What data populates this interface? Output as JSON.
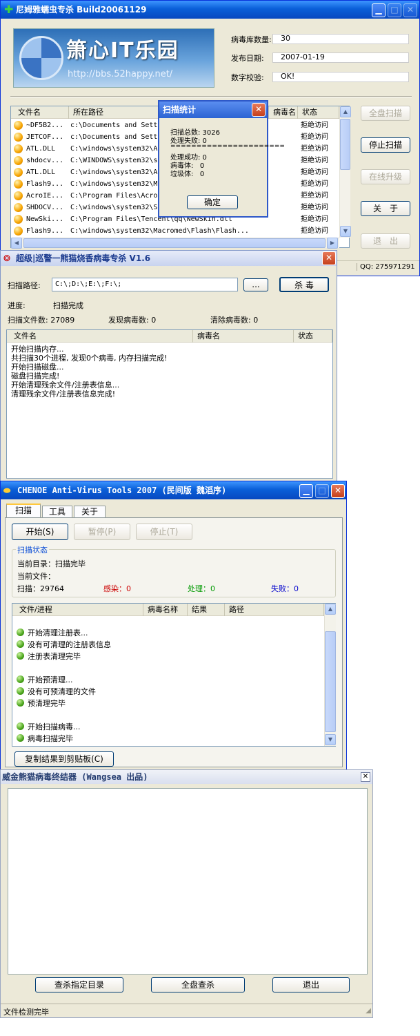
{
  "win1": {
    "title": "尼姆雅蠕虫专杀  Build20061129",
    "logo_text": "箫心IT乐园",
    "logo_url": "http://bbs.52happy.net/",
    "info": [
      {
        "label": "病毒库数量:",
        "value": "30"
      },
      {
        "label": "发布日期:",
        "value": "2007-01-19"
      },
      {
        "label": "数字校验:",
        "value": "OK!"
      }
    ],
    "columns": [
      "文件名",
      "所在路径",
      "病毒名",
      "状态"
    ],
    "rows": [
      {
        "name": "~DF5B2...",
        "path": "c:\\Documents and Sett",
        "status": "拒绝访问"
      },
      {
        "name": "JETCOF...",
        "path": "c:\\Documents and Sett",
        "status": "拒绝访问"
      },
      {
        "name": "ATL.DLL",
        "path": "C:\\windows\\system32\\A",
        "status": "拒绝访问"
      },
      {
        "name": "shdocv...",
        "path": "C:\\WINDOWS\\system32\\s",
        "status": "拒绝访问"
      },
      {
        "name": "ATL.DLL",
        "path": "C:\\windows\\system32\\A",
        "status": "拒绝访问"
      },
      {
        "name": "Flash9...",
        "path": "C:\\windows\\system32\\M",
        "status": "拒绝访问"
      },
      {
        "name": "AcroIE...",
        "path": "C:\\Program Files\\Acro",
        "status": "拒绝访问"
      },
      {
        "name": "SHDOCV...",
        "path": "C:\\windows\\system32\\S",
        "status": "拒绝访问"
      },
      {
        "name": "NewSki...",
        "path": "C:\\Program Files\\Tencent\\qq\\NewSkin.dll",
        "status": "拒绝访问"
      },
      {
        "name": "Flash9...",
        "path": "C:\\windows\\system32\\Macromed\\Flash\\Flash...",
        "status": "拒绝访问"
      }
    ],
    "buttons": {
      "full_scan": "全盘扫描",
      "stop_scan": "停止扫描",
      "online_update": "在线升级",
      "about": "关　于",
      "exit": "退　出"
    },
    "qq": "QQ: 275971291",
    "dialog": {
      "title": "扫描统计",
      "lines": [
        "扫描总数: 3026",
        "处理失败: 0",
        "======================",
        "处理成功: 0",
        "病毒体:   0",
        "垃圾体:   0"
      ],
      "ok": "确定"
    }
  },
  "win2": {
    "title": "超级|巡警一熊猫烧香病毒专杀 V1.6",
    "path_label": "扫描路径:",
    "path_value": "C:\\;D:\\;E:\\;F:\\;",
    "browse": "...",
    "kill": "杀 毒",
    "progress_label": "进度:",
    "progress_value": "扫描完成",
    "scanned": "扫描文件数: 27089",
    "found": "发现病毒数: 0",
    "cleaned": "清除病毒数: 0",
    "columns": [
      "文件名",
      "病毒名",
      "状态"
    ],
    "log": [
      "开始扫描内存...",
      "共扫描30个进程, 发现0个病毒, 内存扫描完成!",
      "开始扫描磁盘...",
      "磁盘扫描完成!",
      "开始清理残余文件/注册表信息...",
      "清理残余文件/注册表信息完成!"
    ]
  },
  "win3": {
    "title": "CHENOE Anti-Virus Tools 2007 (民间版 魏滔序)",
    "tabs": [
      "扫描",
      "工具",
      "关于"
    ],
    "start": "开始(S)",
    "pause": "暂停(P)",
    "stop": "停止(T)",
    "group_title": "扫描状态",
    "current_dir": "当前目录：扫描完毕",
    "current_file": "当前文件：",
    "scanned": "扫描：29764",
    "infected": "感染：0",
    "handled": "处理：0",
    "failed": "失败：0",
    "columns": [
      "文件/进程",
      "病毒名称",
      "结果",
      "路径"
    ],
    "log": [
      {
        "text": "开始清理注册表..."
      },
      {
        "text": "没有可清理的注册表信息"
      },
      {
        "text": "注册表清理完毕"
      },
      {
        "text": ""
      },
      {
        "text": "开始预清理..."
      },
      {
        "text": "没有可预清理的文件"
      },
      {
        "text": "预清理完毕"
      },
      {
        "text": ""
      },
      {
        "text": "开始扫描病毒..."
      },
      {
        "text": "病毒扫描完毕"
      }
    ],
    "copy": "复制结果到剪贴板(C)",
    "colors": {
      "infected": "#cc0000",
      "handled": "#009900",
      "failed": "#0000cc"
    }
  },
  "win4": {
    "title": "威金熊猫病毒终结器  (Wangsea 出品)",
    "btn_dir": "查杀指定目录",
    "btn_full": "全盘查杀",
    "btn_exit": "退出",
    "status": "文件检测完毕"
  }
}
